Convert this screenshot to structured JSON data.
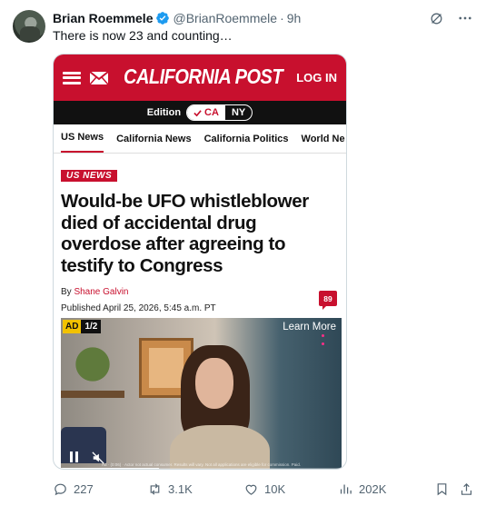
{
  "tweet": {
    "author_name": "Brian Roemmele",
    "handle": "@BrianRoemmele",
    "separator": "·",
    "time": "9h",
    "text": "There is now 23 and counting…"
  },
  "embedded_page": {
    "brand": "CALIFORNIA POST",
    "login_label": "LOG IN",
    "edition_label": "Edition",
    "edition_options": [
      "CA",
      "NY"
    ],
    "edition_selected": "CA",
    "nav_items": [
      "US News",
      "California News",
      "California Politics",
      "World Ne"
    ],
    "section_tag": "US NEWS",
    "headline": "Would-be UFO whistleblower died of accidental drug overdose after agreeing to testify to Congress",
    "byline_prefix": "By",
    "author": "Shane Galvin",
    "published": "Published April 25, 2026, 5:45 a.m. PT",
    "comment_count": "89",
    "ad": {
      "tag": "AD",
      "counter": "1/2",
      "learn_more": "Learn More",
      "fineprint": "Ad · (0:06) · Actor not actual consumer. Results will vary. Not all applications are eligible for commission. Paid.",
      "progress": 0.35
    }
  },
  "actions": {
    "replies": "227",
    "reposts": "3.1K",
    "likes": "10K",
    "views": "202K"
  },
  "colors": {
    "brand_red": "#c8102e",
    "verified_blue": "#1d9bf0",
    "muted_text": "#536471"
  },
  "icons": [
    "verified-badge-icon",
    "grok-icon",
    "more-icon",
    "hamburger-icon",
    "mail-icon",
    "check-icon",
    "pause-icon",
    "mute-icon",
    "reply-icon",
    "retweet-icon",
    "like-icon",
    "views-icon",
    "bookmark-icon",
    "share-icon"
  ]
}
